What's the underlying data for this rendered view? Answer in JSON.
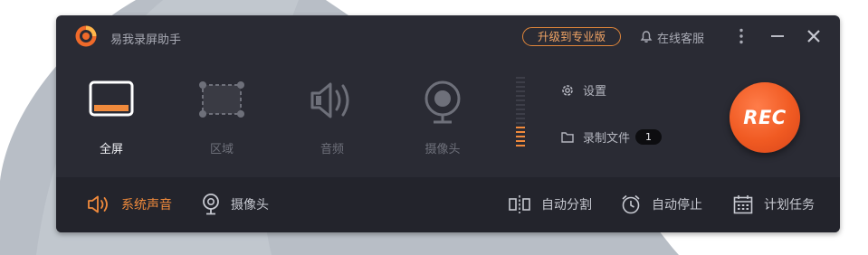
{
  "app": {
    "title": "易我录屏助手",
    "upgrade_label": "升级到专业版",
    "support_label": "在线客服"
  },
  "modes": [
    {
      "label": "全屏",
      "icon": "fullscreen-icon",
      "active": true
    },
    {
      "label": "区域",
      "icon": "region-icon",
      "active": false
    },
    {
      "label": "音频",
      "icon": "audio-icon",
      "active": false
    },
    {
      "label": "摄像头",
      "icon": "webcam-icon",
      "active": false
    }
  ],
  "side": {
    "settings_label": "设置",
    "recordings_label": "录制文件",
    "recordings_count": "1"
  },
  "rec_label": "REC",
  "bottom": {
    "system_audio_label": "系统声音",
    "webcam_label": "摄像头",
    "auto_split_label": "自动分割",
    "auto_stop_label": "自动停止",
    "schedule_label": "计划任务"
  },
  "colors": {
    "window_bg": "#2a2b34",
    "bottom_bg": "#23242c",
    "accent": "#f08a3c",
    "rec": "#f05a22"
  }
}
